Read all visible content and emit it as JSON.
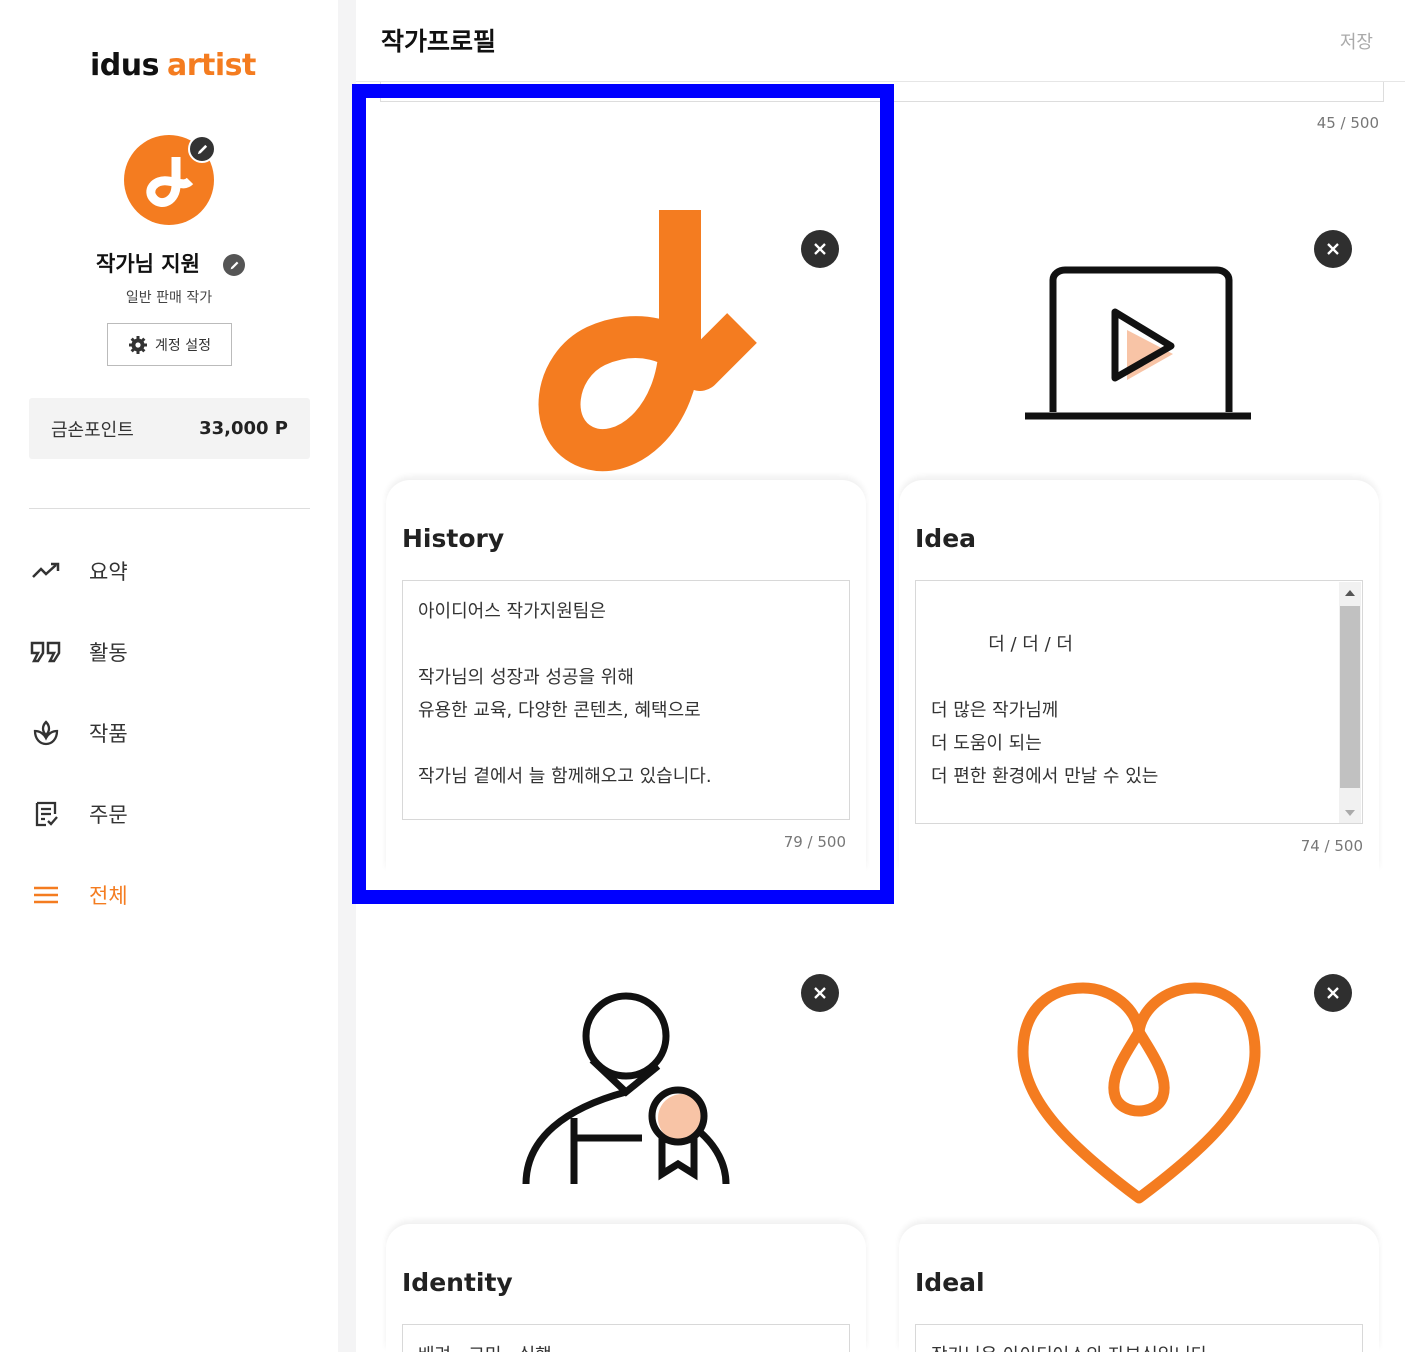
{
  "brand": {
    "logo_part1": "idus",
    "logo_part2": "artist",
    "accent_color": "#f47c20"
  },
  "profile": {
    "name": "작가님 지원",
    "type": "일반 판매 작가",
    "account_settings_label": "계정 설정"
  },
  "points": {
    "label": "금손포인트",
    "value": "33,000 P"
  },
  "nav": {
    "items": [
      {
        "label": "요약",
        "icon": "trend-icon"
      },
      {
        "label": "활동",
        "icon": "quote-icon"
      },
      {
        "label": "작품",
        "icon": "leaf-icon"
      },
      {
        "label": "주문",
        "icon": "order-list-icon"
      },
      {
        "label": "전체",
        "icon": "menu-icon",
        "active": true
      }
    ]
  },
  "header": {
    "title": "작가프로필",
    "save_label": "저장"
  },
  "prev_counter": "45 / 500",
  "cards": [
    {
      "title": "History",
      "image": "idus-logo-image",
      "text": "아이디어스 작가지원팀은\n\n작가님의 성장과 성공을 위해\n유용한 교육, 다양한 콘텐츠, 혜택으로\n\n작가님 곁에서 늘 함께해오고 있습니다.",
      "counter": "79 / 500"
    },
    {
      "title": "Idea",
      "image": "laptop-play-image",
      "text": "더 / 더 / 더\n\n더 많은 작가님께\n더 도움이 되는\n더 편한 환경에서 만날 수 있는\n\n작가님을 위한 콘텐츠를 고민합니다.",
      "counter": "74 / 500"
    },
    {
      "title": "Identity",
      "image": "person-medal-image",
      "text": "배려 · 고민 · 실행"
    },
    {
      "title": "Ideal",
      "image": "heart-image",
      "text": "작가님은 아이디어스의 자부심입니다."
    }
  ]
}
